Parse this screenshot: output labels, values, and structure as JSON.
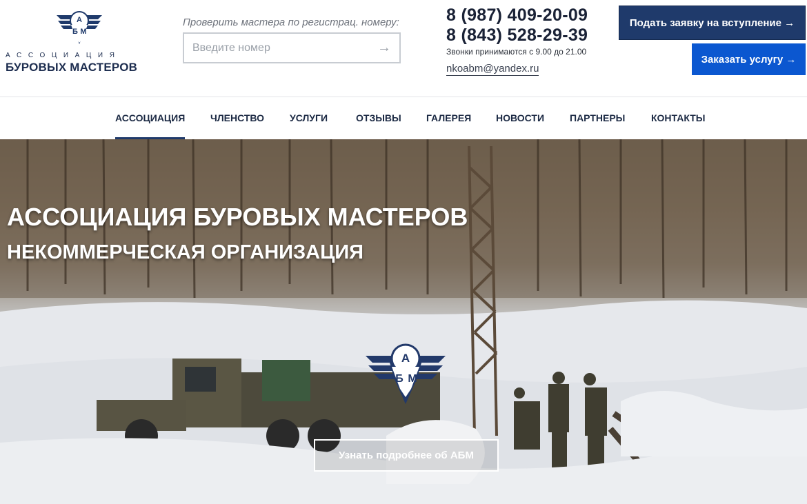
{
  "logo": {
    "line1": "АССОЦИАЦИЯ",
    "line2": "БУРОВЫХ МАСТЕРОВ",
    "emblem_letters": [
      "А",
      "Б",
      "М"
    ],
    "icon": "abm-emblem-icon"
  },
  "check": {
    "label": "Проверить мастера по регистрац. номеру:",
    "placeholder": "Введите номер",
    "value": "",
    "arrow": "→"
  },
  "contacts": {
    "phone1": "8 (987) 409-20-09",
    "phone2": "8 (843) 528-29-39",
    "hours": "Звонки принимаются с 9.00 до 21.00",
    "email": "nkoabm@yandex.ru"
  },
  "buttons": {
    "join": "Подать заявку на вступление →",
    "order": "Заказать услугу →"
  },
  "nav": {
    "items": [
      {
        "label": "АССОЦИАЦИЯ",
        "active": true
      },
      {
        "label": "ЧЛЕНСТВО",
        "active": false
      },
      {
        "label": "УСЛУГИ",
        "active": false
      },
      {
        "label": "ОТЗЫВЫ",
        "active": false
      },
      {
        "label": "ГАЛЕРЕЯ",
        "active": false
      },
      {
        "label": "НОВОСТИ",
        "active": false
      },
      {
        "label": "ПАРТНЕРЫ",
        "active": false
      },
      {
        "label": "КОНТАКТЫ",
        "active": false
      }
    ]
  },
  "hero": {
    "title": "АССОЦИАЦИЯ БУРОВЫХ МАСТЕРОВ",
    "subtitle": "НЕКОММЕРЧЕСКАЯ ОРГАНИЗАЦИЯ",
    "button": "Узнать подробнее об АБМ"
  },
  "colors": {
    "brand_dark": "#1f3a6b",
    "brand_blue": "#0b57d0",
    "text": "#1c2a44"
  }
}
